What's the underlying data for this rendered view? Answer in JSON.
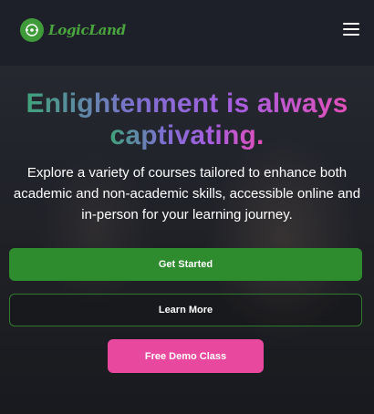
{
  "header": {
    "logo_text": "LogicLand",
    "logo_icon": "logo-mark-icon",
    "menu_icon": "hamburger-menu-icon"
  },
  "hero": {
    "title_line1": "Enlightenment is always",
    "title_line2": "captivating.",
    "subtitle": "Explore a variety of courses tailored to enhance both academic and non-academic skills, accessible online and in-person for your learning journey."
  },
  "buttons": {
    "get_started": "Get Started",
    "learn_more": "Learn More",
    "free_demo": "Free Demo Class"
  },
  "colors": {
    "brand_green": "#2e8b2e",
    "accent_pink": "#e8499f",
    "gradient": [
      "#3fa37a",
      "#7f6fd2",
      "#a65ee0",
      "#e24fb8"
    ]
  }
}
